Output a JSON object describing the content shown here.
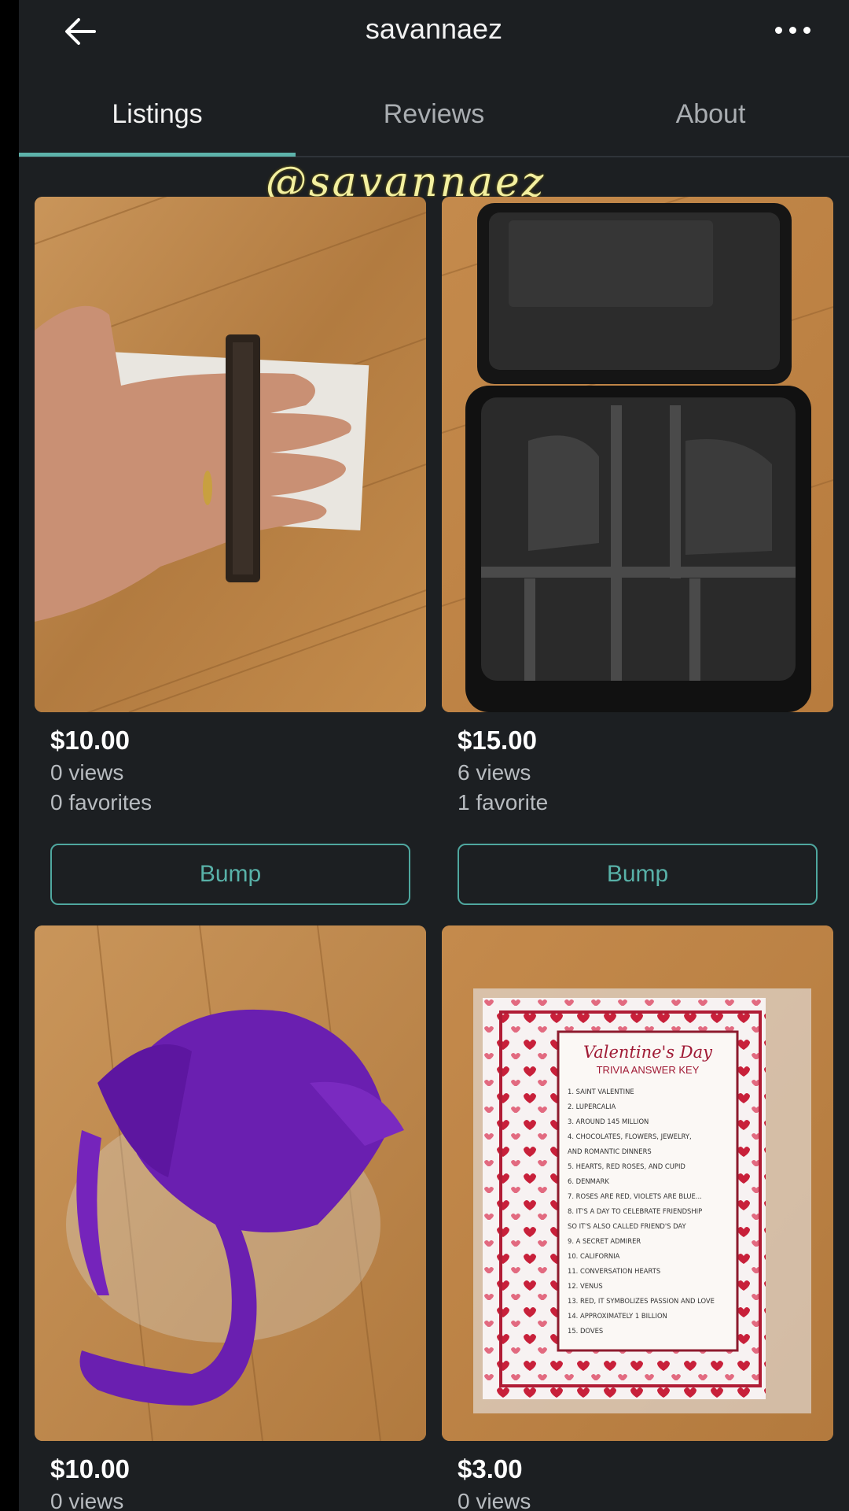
{
  "header": {
    "title": "savannaez",
    "back_icon": "arrow-left-icon",
    "more_icon": "more-horizontal-icon"
  },
  "tabs": [
    {
      "label": "Listings",
      "active": true
    },
    {
      "label": "Reviews",
      "active": false
    },
    {
      "label": "About",
      "active": false
    }
  ],
  "watermark": "@savannaez",
  "colors": {
    "background": "#1c1f22",
    "accent": "#5db3ab",
    "text_secondary": "#b8bcc0"
  },
  "listings": [
    {
      "price": "$10.00",
      "views": "0 views",
      "favorites": "0 favorites",
      "bump_label": "Bump",
      "image": "hand holding drawer pull handle"
    },
    {
      "price": "$15.00",
      "views": "6 views",
      "favorites": "1 favorite",
      "bump_label": "Bump",
      "image": "black makeup travel case"
    },
    {
      "price": "$10.00",
      "views": "0 views",
      "image": "purple wig with braid"
    },
    {
      "price": "$3.00",
      "views": "0 views",
      "image": "Valentine's Day trivia answer key print"
    }
  ],
  "trivia_card": {
    "title": "Valentine's Day",
    "subtitle": "TRIVIA ANSWER KEY",
    "lines": [
      "1. SAINT VALENTINE",
      "2. LUPERCALIA",
      "3. AROUND 145 MILLION",
      "4. CHOCOLATES, FLOWERS, JEWELRY,",
      "AND ROMANTIC DINNERS",
      "5. HEARTS, RED ROSES, AND CUPID",
      "6. DENMARK",
      "7. ROSES ARE RED, VIOLETS ARE BLUE...",
      "8. IT'S A DAY TO CELEBRATE FRIENDSHIP",
      "SO IT'S ALSO CALLED FRIEND'S DAY",
      "9. A SECRET ADMIRER",
      "10. CALIFORNIA",
      "11. CONVERSATION HEARTS",
      "12. VENUS",
      "13. RED, IT SYMBOLIZES PASSION AND LOVE",
      "14. APPROXIMATELY 1 BILLION",
      "15. DOVES"
    ]
  }
}
